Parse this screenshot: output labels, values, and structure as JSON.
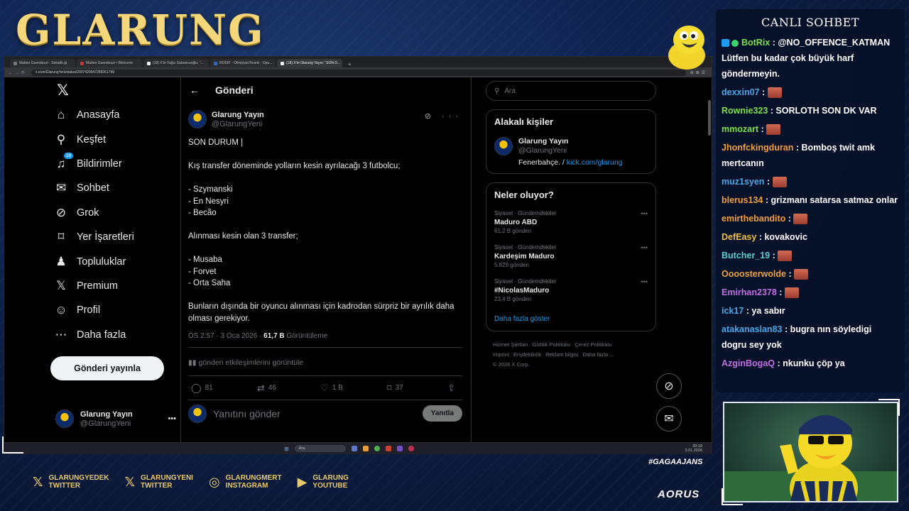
{
  "overlay": {
    "brand": "GLARUNG",
    "tagline": "#GAGAAJANS",
    "sponsor": "AORUS",
    "socials": [
      {
        "icon": "x-icon",
        "line1": "GLARUNGYEDEK",
        "line2": "TWITTER"
      },
      {
        "icon": "x-icon",
        "line1": "GLARUNGYENI",
        "line2": "TWITTER"
      },
      {
        "icon": "instagram-icon",
        "line1": "GLARUNGMERT",
        "line2": "INSTAGRAM"
      },
      {
        "icon": "youtube-icon",
        "line1": "GLARUNG",
        "line2": "YOUTUBE"
      }
    ]
  },
  "browser": {
    "tabs": [
      "Matteo Guendouzi - Sekatik.gr",
      "Matteo Guendouzi • Welcome",
      "(18) X'te Yağız Sabuncuoğlu: \"...",
      "RODIF - Olimpiyat Resmi - Opu...",
      "(18) X'te Glarung Yayın: \"SON D..."
    ],
    "url": "x.com/GlarungYeni/status/2007420947285061749"
  },
  "nav": {
    "items": [
      {
        "label": "Anasayfa",
        "icon": "home-icon"
      },
      {
        "label": "Keşfet",
        "icon": "search-icon"
      },
      {
        "label": "Bildirimler",
        "icon": "bell-icon",
        "badge": "18"
      },
      {
        "label": "Sohbet",
        "icon": "mail-icon"
      },
      {
        "label": "Grok",
        "icon": "grok-icon"
      },
      {
        "label": "Yer İşaretleri",
        "icon": "bookmark-icon"
      },
      {
        "label": "Topluluklar",
        "icon": "people-icon"
      },
      {
        "label": "Premium",
        "icon": "x-icon"
      },
      {
        "label": "Profil",
        "icon": "person-icon"
      },
      {
        "label": "Daha fazla",
        "icon": "more-circle-icon"
      }
    ],
    "post_button": "Gönderi yayınla",
    "account_name": "Glarung Yayın",
    "account_handle": "@GlarungYeni"
  },
  "post": {
    "header": "Gönderi",
    "author": "Glarung Yayın",
    "handle": "@GlarungYeni",
    "text": "SON DURUM |\n\nKış transfer döneminde yolların kesin ayrılacağı 3 futbolcu;\n\n- Szymanski\n- En Nesyri\n- Becão\n\nAlınması kesin olan 3 transfer;\n\n- Musaba\n- Forvet\n- Orta Saha\n\nBunların dışında bir oyuncu alınması için kadrodan sürpriz bir ayrılık daha olması gerekiyor.",
    "time": "ÖS 2:57 · 3 Oca 2026 · ",
    "views": "61,7 B",
    "views_label": " Görüntüleme",
    "engagements": "gönderi etkileşimlerini görüntüle",
    "replies": "81",
    "reposts": "46",
    "likes": "1 B",
    "bookmarks": "37",
    "reply_placeholder": "Yanıtını gönder",
    "reply_button": "Yanıtla"
  },
  "sidebar": {
    "search_placeholder": "Ara",
    "related_title": "Alakalı kişiler",
    "related_name": "Glarung Yayın",
    "related_handle": "@GlarungYeni",
    "related_bio": "Fenerbahçe. / ",
    "related_link": "kick.com/glarung",
    "trends_title": "Neler oluyor?",
    "trends": [
      {
        "category": "Siyaset · Gündemdekiler",
        "title": "Maduro ABD",
        "count": "61,2 B gönderi"
      },
      {
        "category": "Siyaset · Gündemdekiler",
        "title": "Kardeşim Maduro",
        "count": "5.829 gönderi"
      },
      {
        "category": "Siyaset · Gündemdekiler",
        "title": "#NicolasMaduro",
        "count": "23,4 B gönderi"
      }
    ],
    "show_more": "Daha fazla göster",
    "footer": [
      "Hizmet Şartları",
      "Gizlilik Politikası",
      "Çerez Politikası",
      "Imprint",
      "Erişilebilirlik",
      "Reklam bilgisi",
      "Daha fazla ...",
      "© 2026 X Corp."
    ]
  },
  "taskbar": {
    "search": "Ara",
    "time": "20:18",
    "date": "3.01.2026"
  },
  "chat": {
    "title": "CANLI SOHBET",
    "messages": [
      {
        "user": "BotRix",
        "color": "#7be04a",
        "text": "@NO_OFFENCE_KATMAN Lütfen bu kadar çok büyük harf göndermeyin.",
        "emote": false
      },
      {
        "user": "dexxin07",
        "color": "#4aa8e8",
        "text": "",
        "emote": true
      },
      {
        "user": "Rownie323",
        "color": "#7be04a",
        "text": "SORLOTH SON DK VAR",
        "emote": false
      },
      {
        "user": "mmozart",
        "color": "#7be04a",
        "text": "",
        "emote": true
      },
      {
        "user": "Jhonfckingduran",
        "color": "#f0a040",
        "text": "Bomboş twit amk mertcanın",
        "emote": false
      },
      {
        "user": "muz1syen",
        "color": "#4aa8e8",
        "text": "",
        "emote": true
      },
      {
        "user": "blerus134",
        "color": "#f0a040",
        "text": "grizmanı satarsa satmaz onlar",
        "emote": false
      },
      {
        "user": "emirthebandito",
        "color": "#f0a040",
        "text": "",
        "emote": true
      },
      {
        "user": "DefEasy",
        "color": "#f0c040",
        "text": "kovakovic",
        "emote": false
      },
      {
        "user": "Butcher_19",
        "color": "#5ad0d0",
        "text": "",
        "emote": true
      },
      {
        "user": "Oooosterwolde",
        "color": "#f0a040",
        "text": "",
        "emote": true
      },
      {
        "user": "Emirhan2378",
        "color": "#c070e0",
        "text": "",
        "emote": true
      },
      {
        "user": "ick17",
        "color": "#4aa8e8",
        "text": "ya sabır",
        "emote": false
      },
      {
        "user": "atakanaslan83",
        "color": "#4aa8e8",
        "text": "bugra nın söyledigi dogru sey yok",
        "emote": false
      },
      {
        "user": "AzginBogaQ",
        "color": "#c070e0",
        "text": "nkunku çöp ya",
        "emote": false
      }
    ]
  }
}
